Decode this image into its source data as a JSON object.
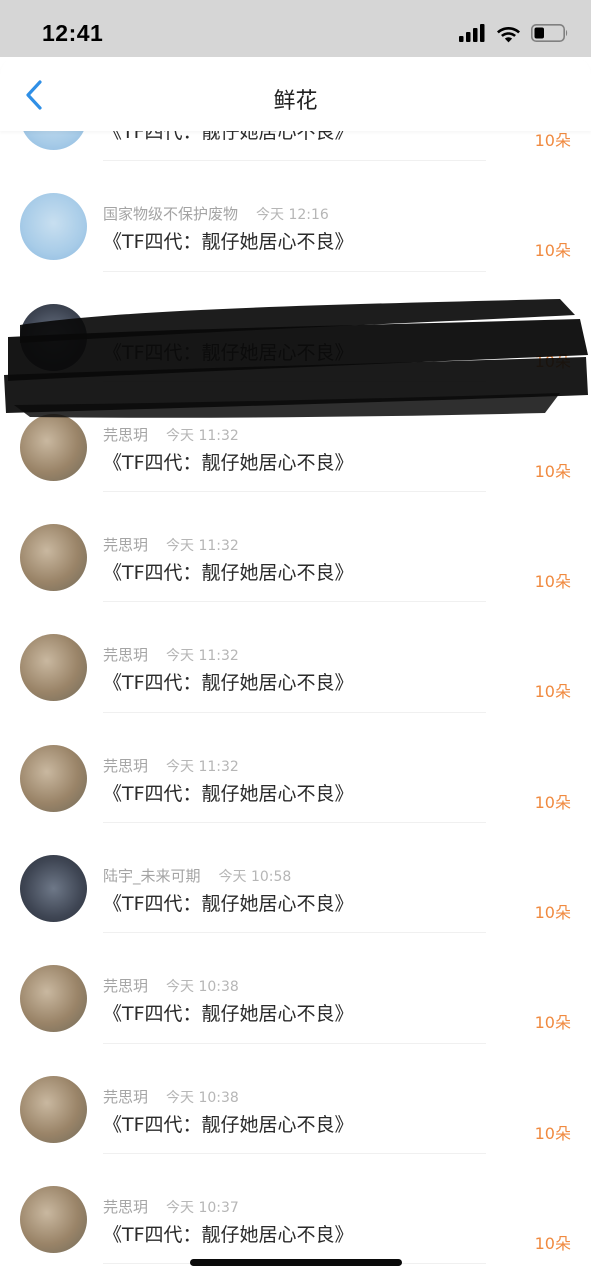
{
  "status_bar": {
    "time": "12:41"
  },
  "nav": {
    "title": "鲜花",
    "back_icon": "chevron-left-icon"
  },
  "colors": {
    "accent": "#f08a40",
    "back_arrow": "#2f8fe6",
    "status_bar_bg": "#d6d6d6"
  },
  "rows": [
    {
      "name": "",
      "time": "",
      "title": "《TF四代：靓仔她居心不良》",
      "count": "10朵"
    },
    {
      "name": "国家物级不保护废物",
      "time": "今天 12:16",
      "title": "《TF四代：靓仔她居心不良》",
      "count": "10朵"
    },
    {
      "name": "",
      "time": "",
      "title": "《TF四代：靓仔她居心不良》",
      "count": "10朵"
    },
    {
      "name": "芫思玥",
      "time": "今天 11:32",
      "title": "《TF四代：靓仔她居心不良》",
      "count": "10朵"
    },
    {
      "name": "芫思玥",
      "time": "今天 11:32",
      "title": "《TF四代：靓仔她居心不良》",
      "count": "10朵"
    },
    {
      "name": "芫思玥",
      "time": "今天 11:32",
      "title": "《TF四代：靓仔她居心不良》",
      "count": "10朵"
    },
    {
      "name": "芫思玥",
      "time": "今天 11:32",
      "title": "《TF四代：靓仔她居心不良》",
      "count": "10朵"
    },
    {
      "name": "陆宇_未来可期",
      "time": "今天 10:58",
      "title": "《TF四代：靓仔她居心不良》",
      "count": "10朵"
    },
    {
      "name": "芫思玥",
      "time": "今天 10:38",
      "title": "《TF四代：靓仔她居心不良》",
      "count": "10朵"
    },
    {
      "name": "芫思玥",
      "time": "今天 10:38",
      "title": "《TF四代：靓仔她居心不良》",
      "count": "10朵"
    },
    {
      "name": "芫思玥",
      "time": "今天 10:37",
      "title": "《TF四代：靓仔她居心不良》",
      "count": "10朵"
    }
  ]
}
